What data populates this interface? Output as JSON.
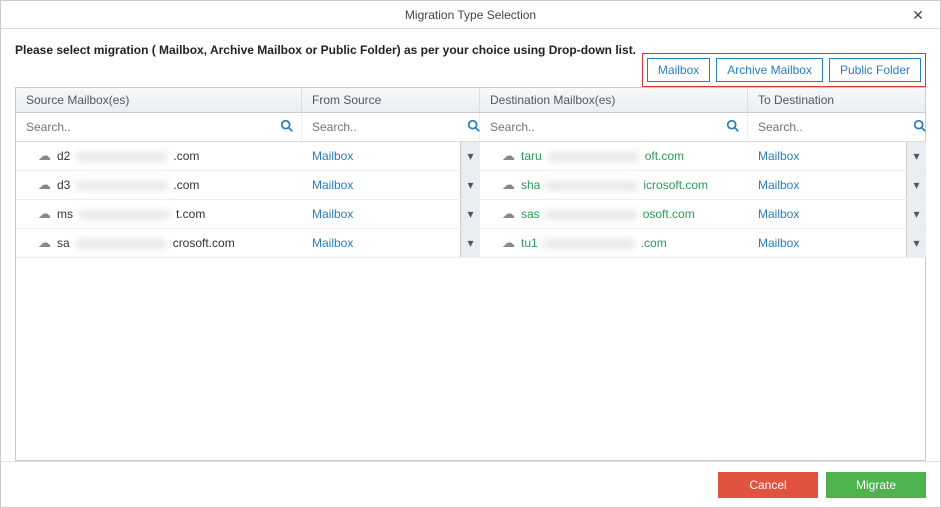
{
  "window": {
    "title": "Migration Type Selection",
    "close": "✕"
  },
  "instruction": "Please select migration ( Mailbox, Archive Mailbox or Public Folder) as per your choice using Drop-down list.",
  "topButtons": {
    "mailbox": "Mailbox",
    "archive": "Archive Mailbox",
    "public": "Public Folder"
  },
  "headers": {
    "sourceMailbox": "Source Mailbox(es)",
    "fromSource": "From Source",
    "destMailbox": "Destination Mailbox(es)",
    "toDest": "To Destination"
  },
  "search": {
    "placeholder": "Search.."
  },
  "dropdown": {
    "mailbox": "Mailbox",
    "arrow": "▾"
  },
  "rows": [
    {
      "srcPrefix": "d2",
      "srcSuffix": ".com",
      "destPrefix": "taru",
      "destSuffix": "oft.com"
    },
    {
      "srcPrefix": "d3",
      "srcSuffix": ".com",
      "destPrefix": "sha",
      "destSuffix": "icrosoft.com"
    },
    {
      "srcPrefix": "ms",
      "srcSuffix": "t.com",
      "destPrefix": "sas",
      "destSuffix": "osoft.com"
    },
    {
      "srcPrefix": "sa",
      "srcSuffix": "crosoft.com",
      "destPrefix": "tu1",
      "destSuffix": ".com"
    }
  ],
  "footer": {
    "cancel": "Cancel",
    "migrate": "Migrate"
  }
}
